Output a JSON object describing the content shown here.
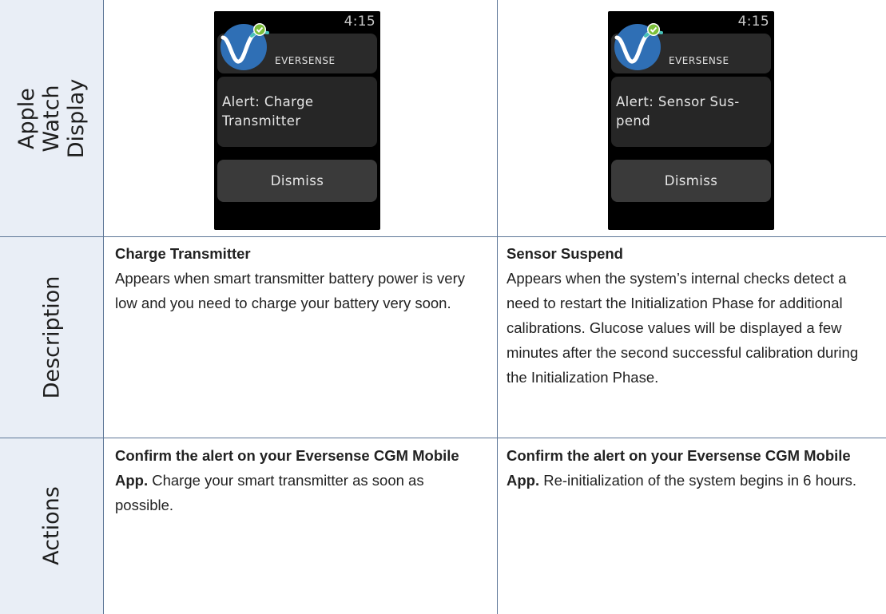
{
  "rows": {
    "display_label": "Apple Watch\nDisplay",
    "description_label": "Description",
    "actions_label": "Actions"
  },
  "watch_left": {
    "time": "4:15",
    "brand": "EVERSENSE",
    "alert": "Alert:  Charge Transmitter",
    "dismiss": "Dismiss"
  },
  "watch_right": {
    "time": "4:15",
    "brand": "EVERSENSE",
    "alert": "Alert:  Sensor Sus-pend",
    "dismiss": "Dismiss"
  },
  "description": {
    "left_title": "Charge Transmitter",
    "left_text": "Appears when smart transmitter battery power is very low and you need to charge your battery very soon.",
    "right_title": "Sensor Suspend",
    "right_text": "Appears when the system’s internal checks detect a need to restart the Initialization Phase for additional calibrations. Glucose values will be displayed a few minutes after the second successful calibration during the Initialization Phase."
  },
  "actions": {
    "left_bold": "Confirm the alert on your Eversense CGM Mobile App.",
    "left_text": " Charge your smart transmitter as soon as possible.",
    "right_bold": "Confirm the alert on your Eversense CGM Mobile App.",
    "right_text": " Re-initialization of the system begins in 6 hours."
  },
  "colors": {
    "sidebar_bg": "#e9eef6",
    "rule": "#5d7697",
    "logo_blue": "#2f6fb5",
    "logo_teal": "#46c2b9",
    "check_green": "#7cbf3b"
  }
}
